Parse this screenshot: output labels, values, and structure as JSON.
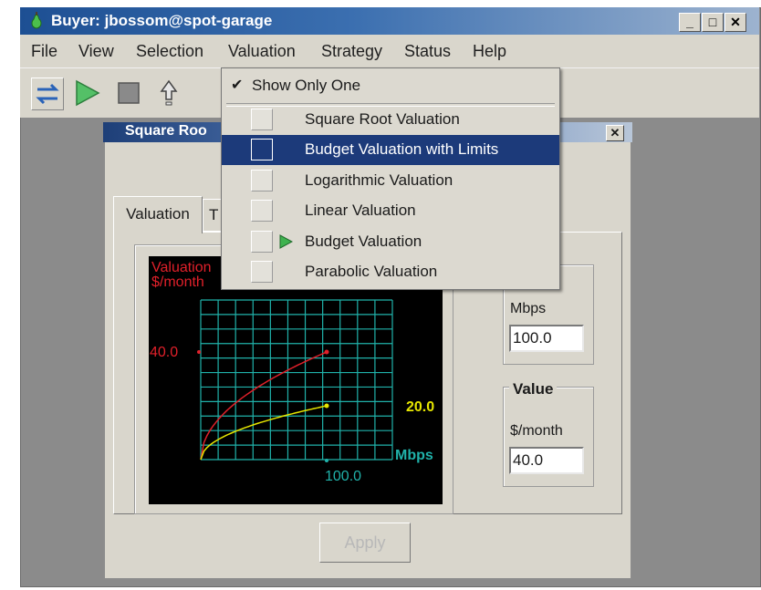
{
  "window": {
    "title": "Buyer: jbossom@spot-garage",
    "btn_min": "_",
    "btn_max": "□",
    "btn_close": "✕"
  },
  "menubar": [
    "File",
    "View",
    "Selection",
    "Valuation",
    "Strategy",
    "Status",
    "Help"
  ],
  "toolbar": {
    "icons": [
      "swap-arrows-icon",
      "play-icon",
      "stop-icon",
      "up-arrow-icon"
    ]
  },
  "dialog": {
    "title": "Square Roo",
    "close": "✕",
    "tabs": [
      "Valuation",
      "T"
    ],
    "graph": {
      "y_label_line1": "Valuation",
      "y_label_line2": "$/month",
      "y_value": "40.0",
      "yellow_value": "20.0",
      "x_unit": "Mbps",
      "x_value": "100.0"
    },
    "rate": {
      "unit": "Mbps",
      "value": "100.0"
    },
    "value": {
      "legend": "Value",
      "unit": "$/month",
      "value": "40.0"
    },
    "apply_label": "Apply"
  },
  "dropdown": {
    "show_only_one": {
      "check": "✔",
      "label": "Show Only One"
    },
    "items": [
      {
        "label": "Square Root Valuation"
      },
      {
        "label": "Budget Valuation with Limits"
      },
      {
        "label": "Logarithmic Valuation"
      },
      {
        "label": "Linear Valuation"
      },
      {
        "label": "Budget Valuation"
      },
      {
        "label": "Parabolic Valuation"
      }
    ]
  },
  "colors": {
    "red_curve": "#e0202a",
    "yellow_curve": "#e6e600",
    "grid": "#20b2aa",
    "highlight": "#1c3a7a"
  },
  "chart_data": {
    "type": "line",
    "series": [
      {
        "x": [
          0,
          25,
          50,
          75,
          100
        ],
        "y": [
          0,
          20,
          28.3,
          34.6,
          40
        ]
      },
      {
        "x": [
          0,
          25,
          50,
          75,
          100
        ],
        "y": [
          0,
          10,
          14.1,
          17.3,
          20
        ]
      }
    ],
    "ylabel": "Valuation $/month",
    "xlabel": "Mbps",
    "xlim": [
      0,
      100
    ],
    "ylim": [
      0,
      40
    ],
    "grid": true
  }
}
